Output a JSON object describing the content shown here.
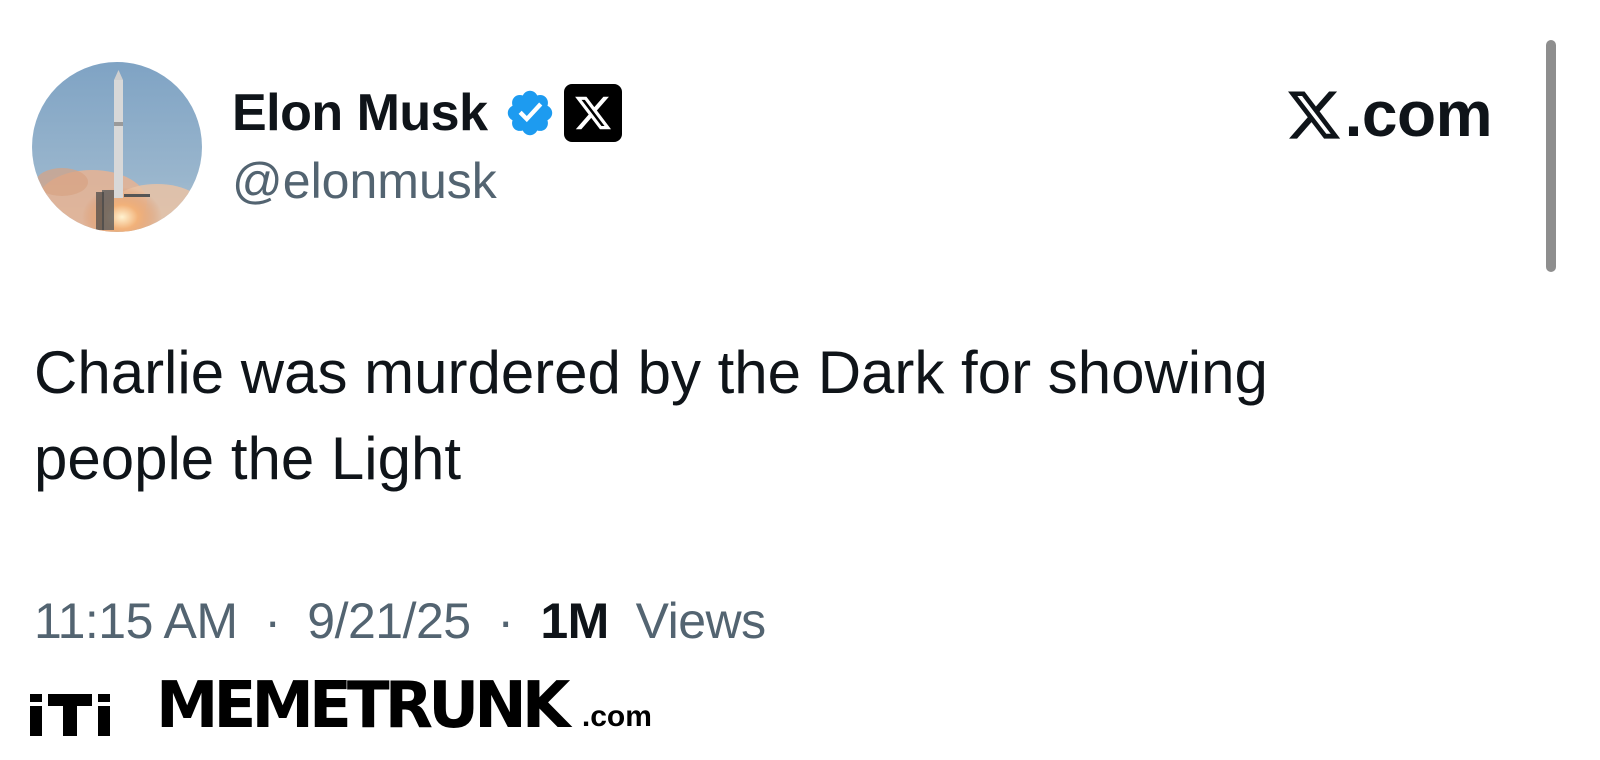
{
  "author": {
    "display_name": "Elon Musk",
    "handle": "@elonmusk",
    "avatar_icon": "rocket-launch-avatar",
    "verified": true,
    "verified_color": "#1d9bf0",
    "affiliate_badge_icon": "x-logo-icon"
  },
  "header": {
    "site_logo_text": ".com",
    "site_logo_icon": "x-logo-icon"
  },
  "tweet": {
    "text": "Charlie was murdered by the Dark for showing people the Light"
  },
  "meta": {
    "time": "11:15 AM",
    "separator": "·",
    "date": "9/21/25",
    "views_count": "1M",
    "views_label": "Views"
  },
  "watermark": {
    "name": "MEMETRUNK",
    "suffix": ".com"
  },
  "colors": {
    "text_primary": "#0f1419",
    "text_secondary": "#536471",
    "verified_blue": "#1d9bf0"
  }
}
